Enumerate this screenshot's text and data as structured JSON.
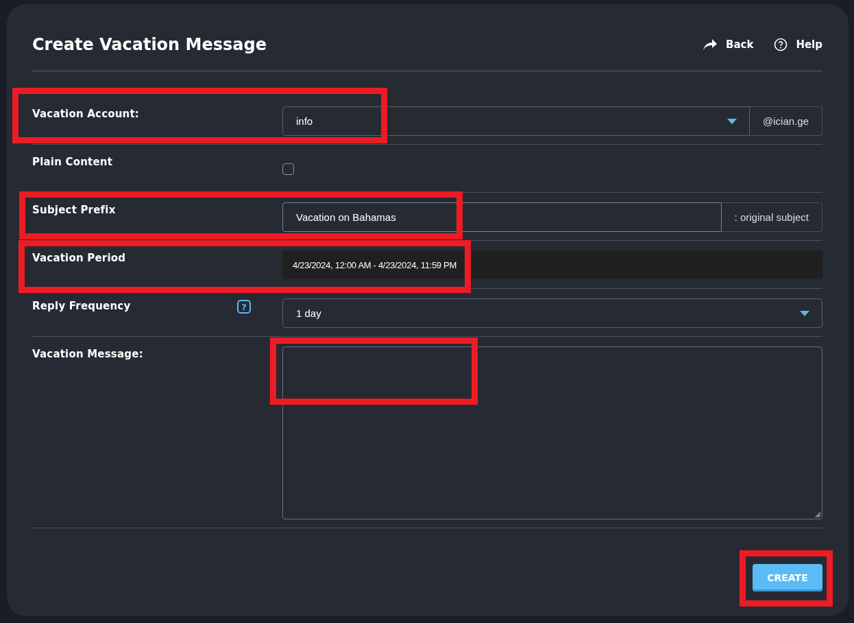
{
  "header": {
    "title": "Create Vacation Message",
    "actions": [
      {
        "kind": "back",
        "label": "Back"
      },
      {
        "kind": "help",
        "label": "Help"
      }
    ]
  },
  "rows": [
    {
      "kind": "select",
      "label": "Vacation Account:",
      "value": "info",
      "suffix": "@ician.ge"
    },
    {
      "kind": "checkbox",
      "label": "Plain Content",
      "checked": false
    },
    {
      "kind": "text",
      "label": "Subject Prefix",
      "value": "Vacation on Bahamas",
      "suffix": ": original subject"
    },
    {
      "kind": "daterange",
      "label": "Vacation Period",
      "value": "4/23/2024, 12:00 AM - 4/23/2024, 11:59 PM"
    },
    {
      "kind": "select",
      "label": "Reply Frequency",
      "value": "1 day",
      "help_badge": "?"
    },
    {
      "kind": "textarea",
      "label": "Vacation Message:"
    }
  ],
  "submit": {
    "label": "CREATE"
  }
}
